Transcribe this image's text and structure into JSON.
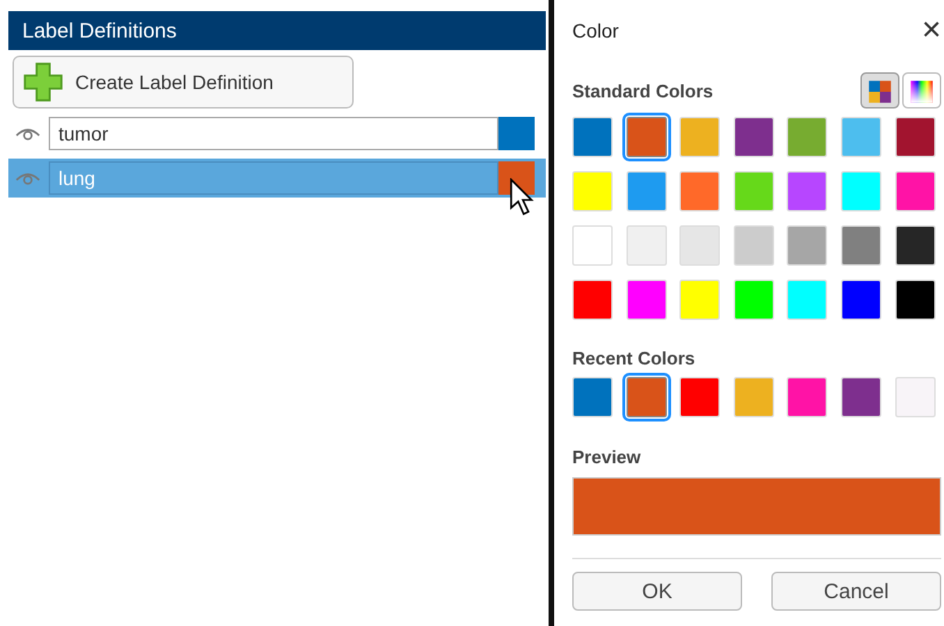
{
  "label_panel": {
    "title": "Label Definitions",
    "create_button": "Create Label Definition",
    "labels": [
      {
        "name": "tumor",
        "color": "#0072bd",
        "selected": false
      },
      {
        "name": "lung",
        "color": "#d95319",
        "selected": true
      }
    ]
  },
  "color_dialog": {
    "title": "Color",
    "close": "×",
    "standard_label": "Standard Colors",
    "modes": [
      {
        "kind": "swatches",
        "selected": true
      },
      {
        "kind": "spectrum",
        "selected": false
      }
    ],
    "standard_colors": [
      {
        "color": "#0072bd",
        "selected": false
      },
      {
        "color": "#d95319",
        "selected": true
      },
      {
        "color": "#edb120",
        "selected": false
      },
      {
        "color": "#7e2f8e",
        "selected": false
      },
      {
        "color": "#77ac30",
        "selected": false
      },
      {
        "color": "#4dbeee",
        "selected": false
      },
      {
        "color": "#a2142f",
        "selected": false
      },
      {
        "color": "#ffff00",
        "selected": false
      },
      {
        "color": "#1e9bf0",
        "selected": false
      },
      {
        "color": "#ff6929",
        "selected": false
      },
      {
        "color": "#66d91a",
        "selected": false
      },
      {
        "color": "#b746ff",
        "selected": false
      },
      {
        "color": "#00ffff",
        "selected": false
      },
      {
        "color": "#ff13a6",
        "selected": false
      },
      {
        "color": "#ffffff",
        "selected": false
      },
      {
        "color": "#f0f0f0",
        "selected": false
      },
      {
        "color": "#e6e6e6",
        "selected": false
      },
      {
        "color": "#cccccc",
        "selected": false
      },
      {
        "color": "#a6a6a6",
        "selected": false
      },
      {
        "color": "#808080",
        "selected": false
      },
      {
        "color": "#262626",
        "selected": false
      },
      {
        "color": "#ff0000",
        "selected": false
      },
      {
        "color": "#ff00ff",
        "selected": false
      },
      {
        "color": "#ffff00",
        "selected": false
      },
      {
        "color": "#00ff00",
        "selected": false
      },
      {
        "color": "#00ffff",
        "selected": false
      },
      {
        "color": "#0000ff",
        "selected": false
      },
      {
        "color": "#000000",
        "selected": false
      }
    ],
    "recent_label": "Recent Colors",
    "recent_colors": [
      {
        "color": "#0072bd",
        "selected": false
      },
      {
        "color": "#d95319",
        "selected": true
      },
      {
        "color": "#ff0000",
        "selected": false
      },
      {
        "color": "#edb120",
        "selected": false
      },
      {
        "color": "#ff13a6",
        "selected": false
      },
      {
        "color": "#7e2f8e",
        "selected": false
      },
      {
        "color": "#f8f4f8",
        "selected": false
      }
    ],
    "preview_label": "Preview",
    "buttons": [
      "OK",
      "Cancel"
    ]
  }
}
